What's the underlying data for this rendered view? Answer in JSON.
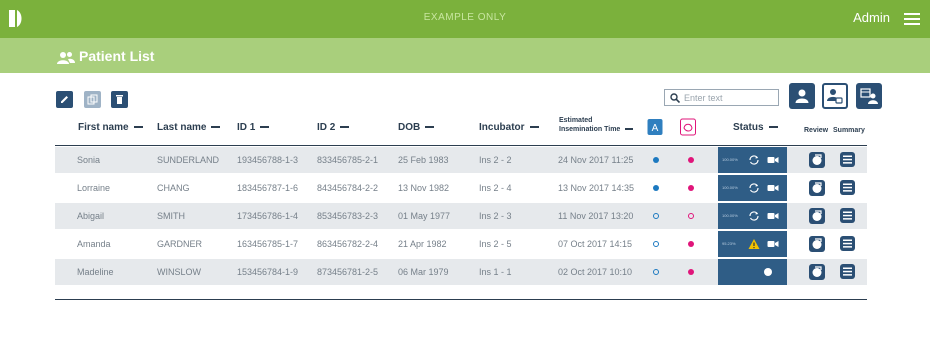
{
  "header": {
    "banner": "EXAMPLE ONLY",
    "user": "Admin"
  },
  "page": {
    "title": "Patient List"
  },
  "search": {
    "placeholder": "Enter text",
    "value": ""
  },
  "columns": {
    "first_name": "First name",
    "last_name": "Last name",
    "id1": "ID 1",
    "id2": "ID 2",
    "dob": "DOB",
    "incubator": "Incubator",
    "insem_line1": "Estimated",
    "insem_line2": "Insemination Time",
    "status": "Status",
    "review": "Review",
    "summary": "Summary"
  },
  "icons": {
    "tool_edit": "pencil-icon",
    "tool_copy": "copy-icon",
    "tool_delete": "trash-icon",
    "view1": "single-user-icon",
    "view2": "user-dish-icon",
    "view3": "calendar-users-icon"
  },
  "colors": {
    "top_bar": "#7bb13c",
    "sub_bar": "#a9cf7c",
    "navy": "#2b4f74",
    "status_bg": "#2f5d86",
    "blue_dot": "#1c79c0",
    "pink_dot": "#e0157a",
    "warning": "#f2c200"
  },
  "patients": [
    {
      "first": "Sonia",
      "last": "SUNDERLAND",
      "id1": "193456788-1-3",
      "id2": "833456785-2-1",
      "dob": "25 Feb 1983",
      "incubator": "Ins 2 - 2",
      "insem": "24 Nov 2017 11:25",
      "dot1": "filled",
      "dot2": "filled",
      "status_pct": "100.00%",
      "status_icon": "sync",
      "video": true
    },
    {
      "first": "Lorraine",
      "last": "CHANG",
      "id1": "183456787-1-6",
      "id2": "843456784-2-2",
      "dob": "13 Nov 1982",
      "incubator": "Ins 2 - 4",
      "insem": "13 Nov 2017 14:35",
      "dot1": "filled",
      "dot2": "filled",
      "status_pct": "100.00%",
      "status_icon": "sync",
      "video": true
    },
    {
      "first": "Abigail",
      "last": "SMITH",
      "id1": "173456786-1-4",
      "id2": "853456783-2-3",
      "dob": "01 May 1977",
      "incubator": "Ins 2 - 3",
      "insem": "11 Nov 2017 13:20",
      "dot1": "ring",
      "dot2": "ring",
      "status_pct": "100.00%",
      "status_icon": "sync",
      "video": true
    },
    {
      "first": "Amanda",
      "last": "GARDNER",
      "id1": "163456785-1-7",
      "id2": "863456782-2-4",
      "dob": "21 Apr 1982",
      "incubator": "Ins 2 - 5",
      "insem": "07 Oct 2017 14:15",
      "dot1": "ring",
      "dot2": "filled",
      "status_pct": "95.23%",
      "status_icon": "warning",
      "video": true
    },
    {
      "first": "Madeline",
      "last": "WINSLOW",
      "id1": "153456784-1-9",
      "id2": "873456781-2-5",
      "dob": "06 Mar 1979",
      "incubator": "Ins 1 - 1",
      "insem": "02 Oct 2017 10:10",
      "dot1": "ring",
      "dot2": "filled",
      "status_pct": "",
      "status_icon": "dot",
      "video": false
    }
  ]
}
